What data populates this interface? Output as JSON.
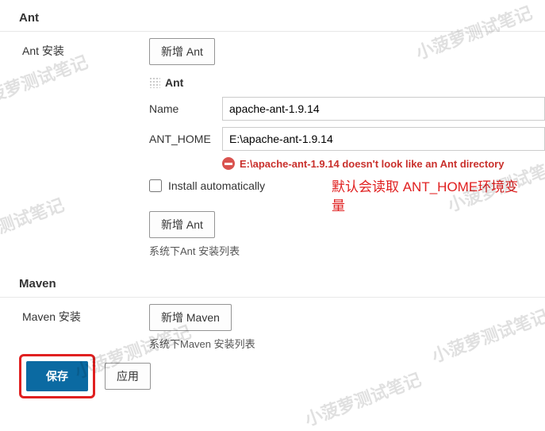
{
  "watermark_text": "小菠萝测试笔记",
  "ant": {
    "section_title": "Ant",
    "install_label": "Ant 安装",
    "add_button": "新增 Ant",
    "block_title": "Ant",
    "name_label": "Name",
    "name_value": "apache-ant-1.9.14",
    "home_label": "ANT_HOME",
    "home_value": "E:\\apache-ant-1.9.14",
    "error_text": "E:\\apache-ant-1.9.14  doesn't look like an Ant directory",
    "install_auto_label": "Install automatically",
    "add_button2": "新增 Ant",
    "list_help": "系统下Ant 安装列表"
  },
  "maven": {
    "section_title": "Maven",
    "install_label": "Maven 安装",
    "add_button": "新增 Maven",
    "list_help": "系统下Maven 安装列表"
  },
  "annotation_text": "默认会读取 ANT_HOME环境变量",
  "footer": {
    "save": "保存",
    "apply": "应用"
  }
}
